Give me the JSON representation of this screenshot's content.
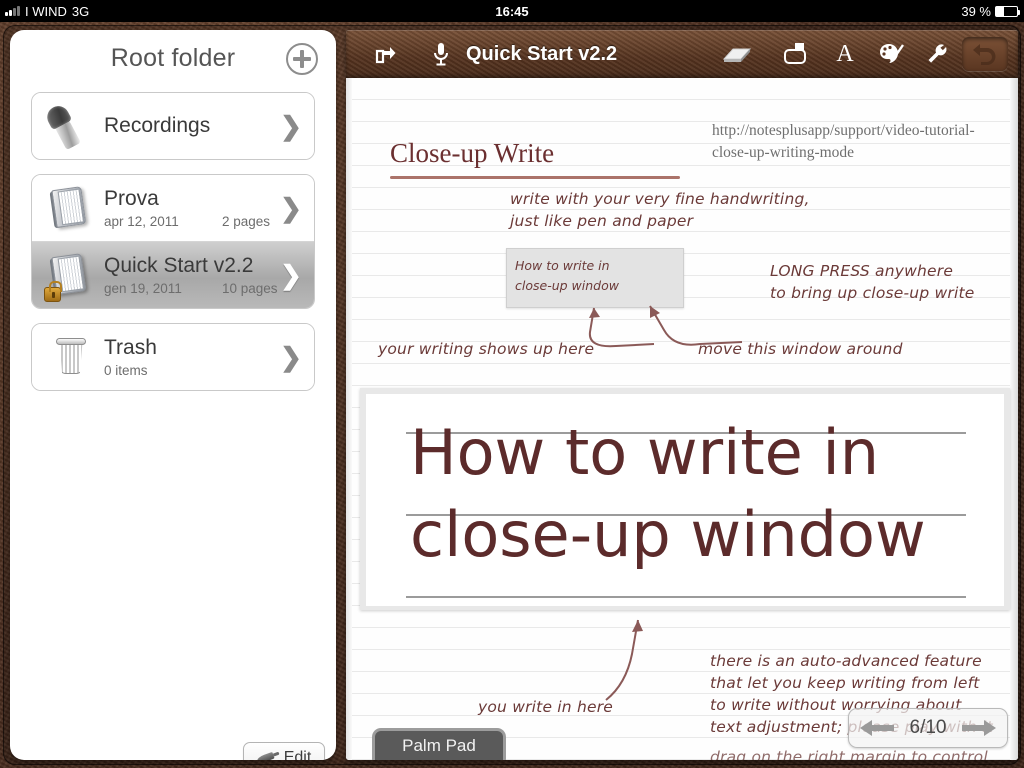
{
  "statusbar": {
    "carrier": "I WIND",
    "network": "3G",
    "time": "16:45",
    "battery": "39 %"
  },
  "sidebar": {
    "title": "Root folder",
    "add_button": "add-folder",
    "groups": [
      {
        "items": [
          {
            "icon": "microphone-icon",
            "name": "Recordings",
            "date": "",
            "pages": "",
            "selected": false,
            "locked": false
          }
        ]
      },
      {
        "items": [
          {
            "icon": "notebook-icon",
            "name": "Prova",
            "date": "apr 12, 2011",
            "pages": "2 pages",
            "selected": false,
            "locked": false
          },
          {
            "icon": "notebook-icon",
            "name": "Quick Start v2.2",
            "date": "gen 19, 2011",
            "pages": "10 pages",
            "selected": true,
            "locked": true
          }
        ]
      },
      {
        "items": [
          {
            "icon": "trash-icon",
            "name": "Trash",
            "date": "0 items",
            "pages": "",
            "selected": false,
            "locked": false
          }
        ]
      }
    ],
    "edit_label": "Edit"
  },
  "toolbar": {
    "title": "Quick Start v2.2",
    "icons": [
      "share-icon",
      "microphone-icon",
      "eraser-icon",
      "lasso-select-icon",
      "text-tool-icon",
      "palette-brush-icon",
      "wrench-icon",
      "undo-icon"
    ]
  },
  "page": {
    "url": "http://notesplusapp/support/video-tutorial-close-up-writing-mode",
    "heading": "Close-up Write",
    "note_1": "write with your very fine handwriting,\njust like pen and paper",
    "closeup_mini_text": "How to write  in\nclose-up window",
    "note_longpress": "LONG PRESS anywhere\nto bring up close-up write",
    "note_shows_up": "your writing shows up here",
    "note_move_window": "move this window around",
    "closeup_text": "How to write in\nclose-up window",
    "note_you_write": "you write in here",
    "note_auto_advance": "there is an auto-advanced feature\nthat let you keep writing from left\nto write without worrying about\ntext adjustment; please play with it",
    "note_drag": "drag on the right margin to control",
    "palm_pad": "Palm Pad",
    "page_indicator": "6/10"
  },
  "colors": {
    "ink": "#6b3a38",
    "heading": "#6b2f30",
    "leather": "#4e3021"
  }
}
